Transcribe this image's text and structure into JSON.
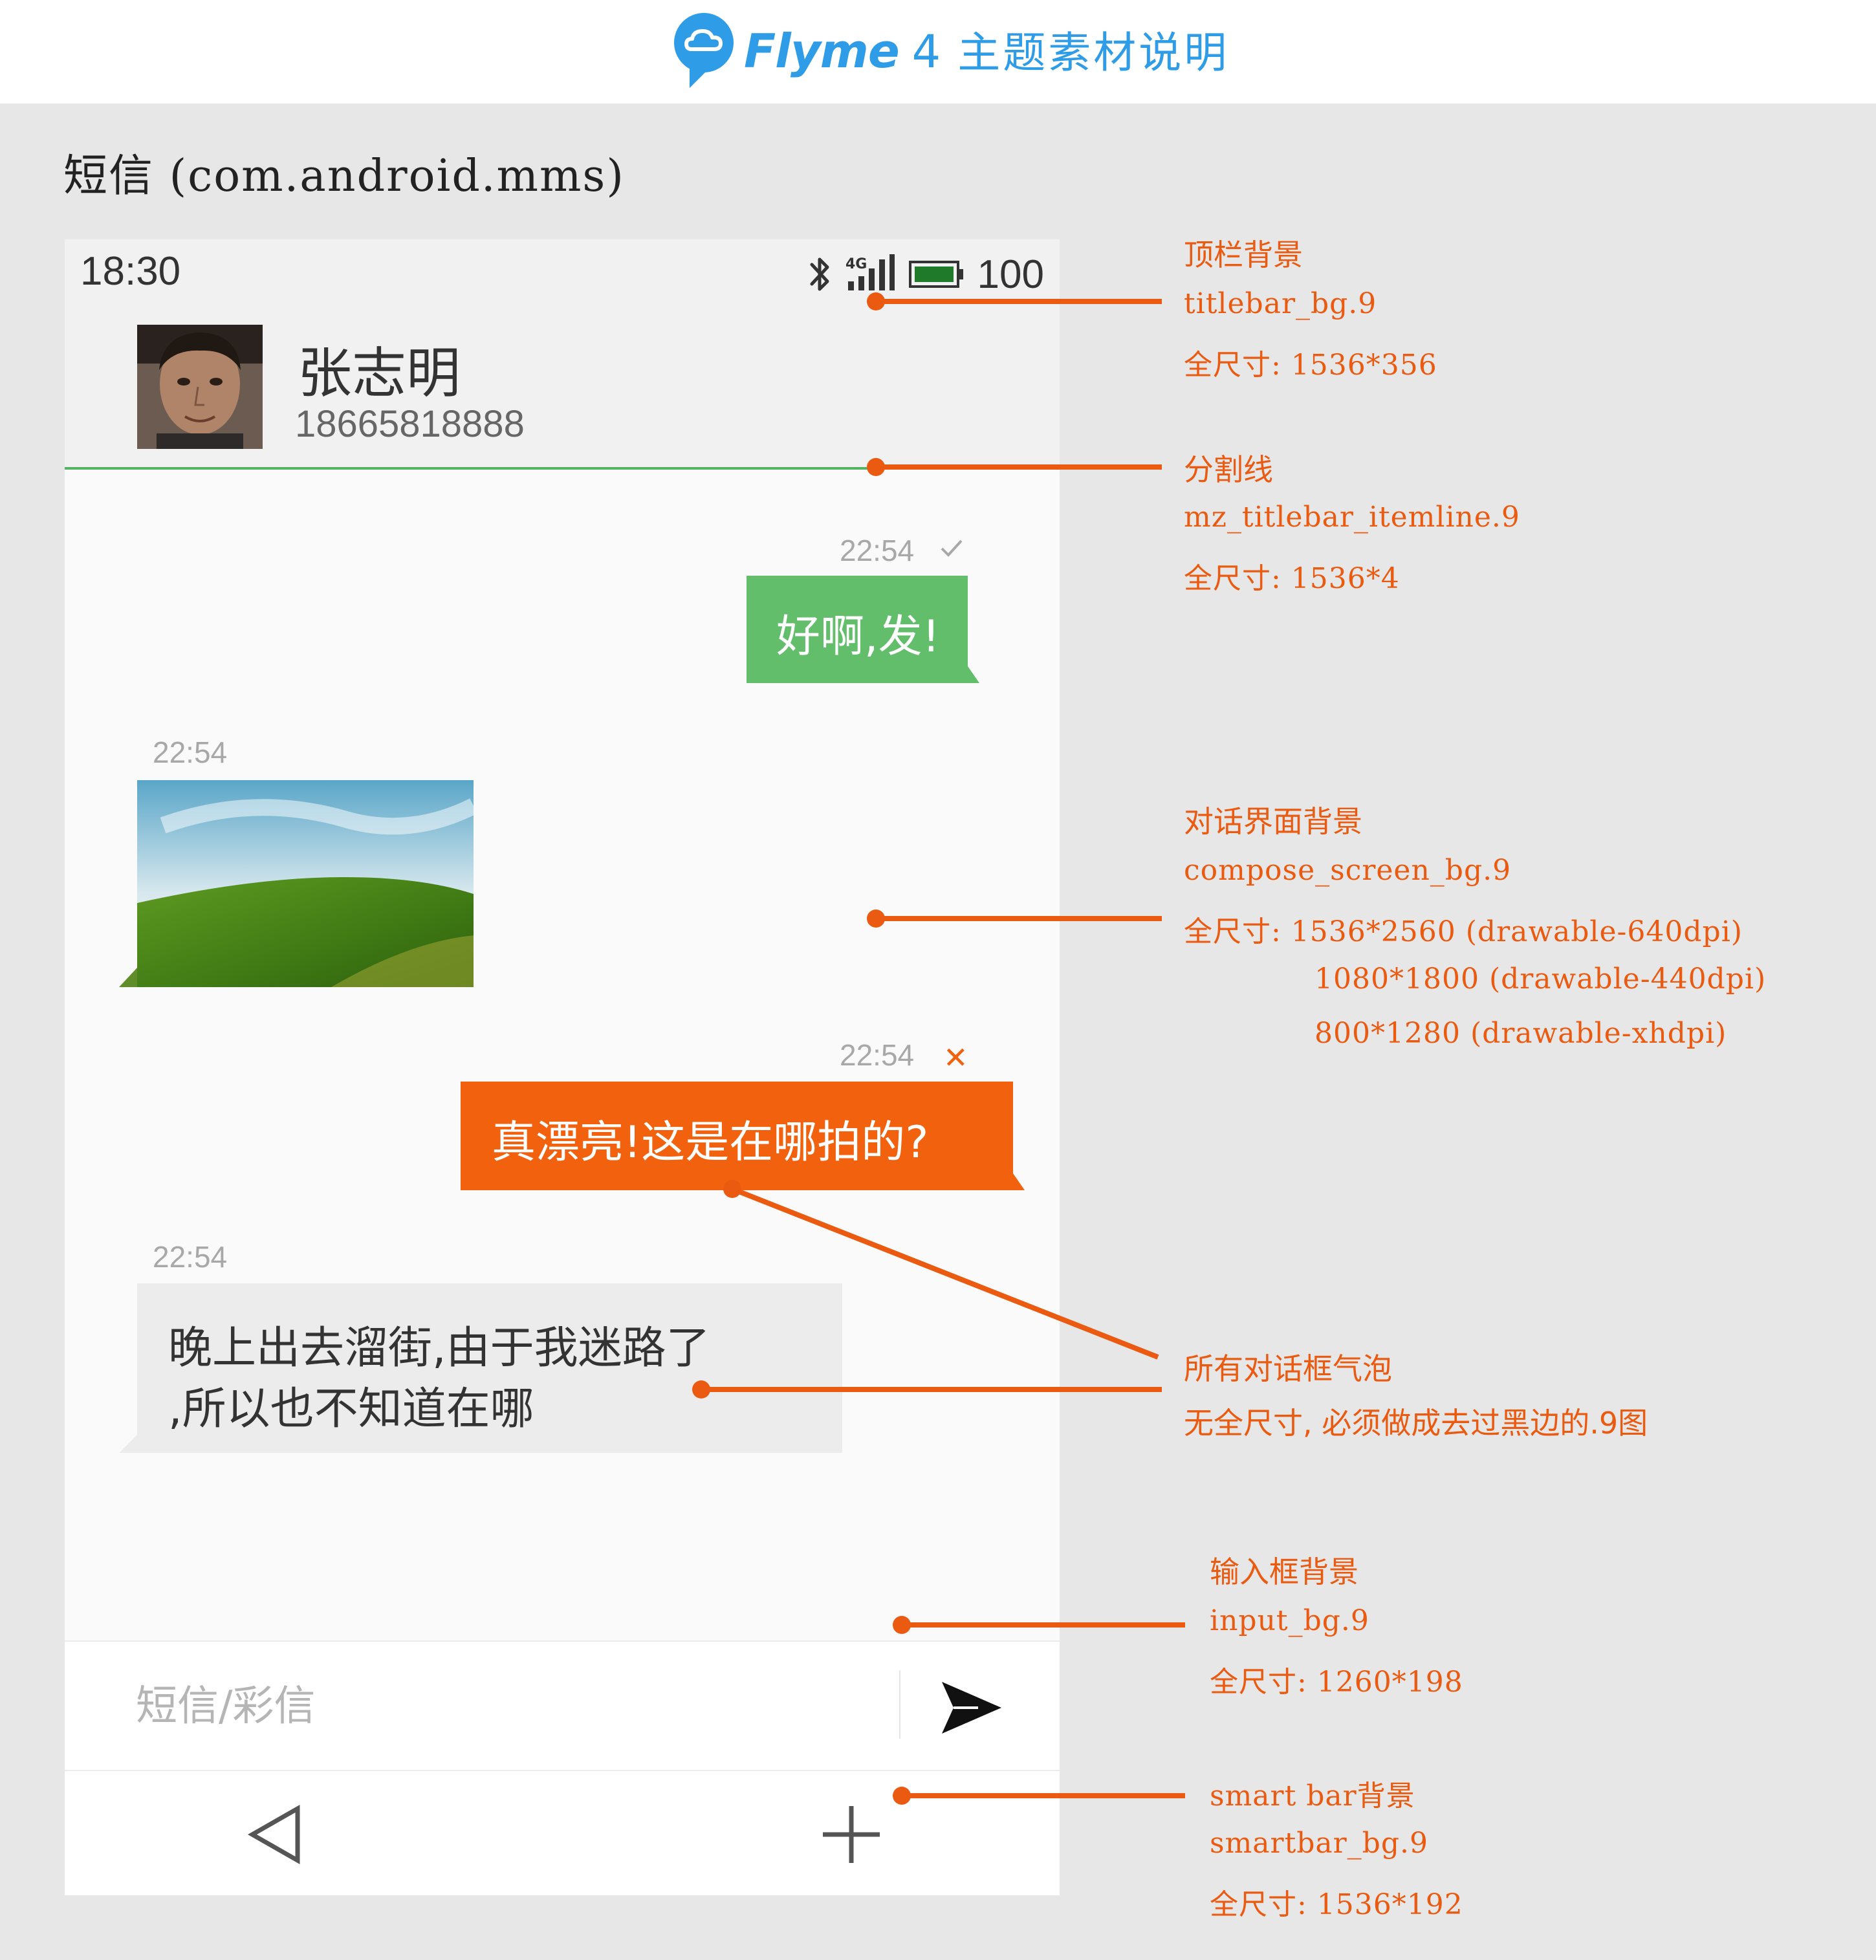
{
  "header": {
    "brand_name": "Flyme",
    "brand_version": "4",
    "subtitle": "主题素材说明"
  },
  "page_title": "短信 (com.android.mms)",
  "phone": {
    "status_bar": {
      "time": "18:30",
      "network_label": "4G",
      "battery": "100"
    },
    "contact": {
      "name": "张志明",
      "number": "18665818888"
    },
    "messages": [
      {
        "direction": "outgoing",
        "time": "22:54",
        "status": "sent",
        "text": "好啊,发!"
      },
      {
        "direction": "incoming",
        "time": "22:54",
        "type": "image"
      },
      {
        "direction": "outgoing",
        "time": "22:54",
        "status": "failed",
        "text": "真漂亮!这是在哪拍的?"
      },
      {
        "direction": "incoming",
        "time": "22:54",
        "lines": [
          "晚上出去溜街,由于我迷路了",
          ",所以也不知道在哪"
        ]
      }
    ],
    "input": {
      "placeholder": "短信/彩信"
    },
    "icons": {
      "bluetooth": "bluetooth-icon",
      "signal": "signal-4g-icon",
      "battery": "battery-icon",
      "sent": "checkmark-icon",
      "failed": "close-icon",
      "send": "send-icon",
      "back": "back-triangle-icon",
      "add": "plus-icon"
    }
  },
  "annotations": {
    "titlebar": {
      "title": "顶栏背景",
      "file": "titlebar_bg.9",
      "size": "全尺寸: 1536*356"
    },
    "divider": {
      "title": "分割线",
      "file": "mz_titlebar_itemline.9",
      "size": "全尺寸: 1536*4"
    },
    "compose_bg": {
      "title": "对话界面背景",
      "file": "compose_screen_bg.9",
      "size": "全尺寸: 1536*2560 (drawable-640dpi)",
      "size_2": "1080*1800 (drawable-440dpi)",
      "size_3": "800*1280 (drawable-xhdpi)"
    },
    "bubbles": {
      "title": "所有对话框气泡",
      "note": "无全尺寸, 必须做成去过黑边的.9图"
    },
    "input_bg": {
      "title": "输入框背景",
      "file": "input_bg.9",
      "size": "全尺寸: 1260*198"
    },
    "smartbar": {
      "title": "smart bar背景",
      "file": "smartbar_bg.9",
      "size": "全尺寸: 1536*192"
    }
  },
  "colors": {
    "brand_blue": "#2e9ce6",
    "annotation_orange": "#ea5a10",
    "bubble_green": "#62be6a",
    "bubble_orange": "#f2620e",
    "divider_green": "#55b464"
  }
}
